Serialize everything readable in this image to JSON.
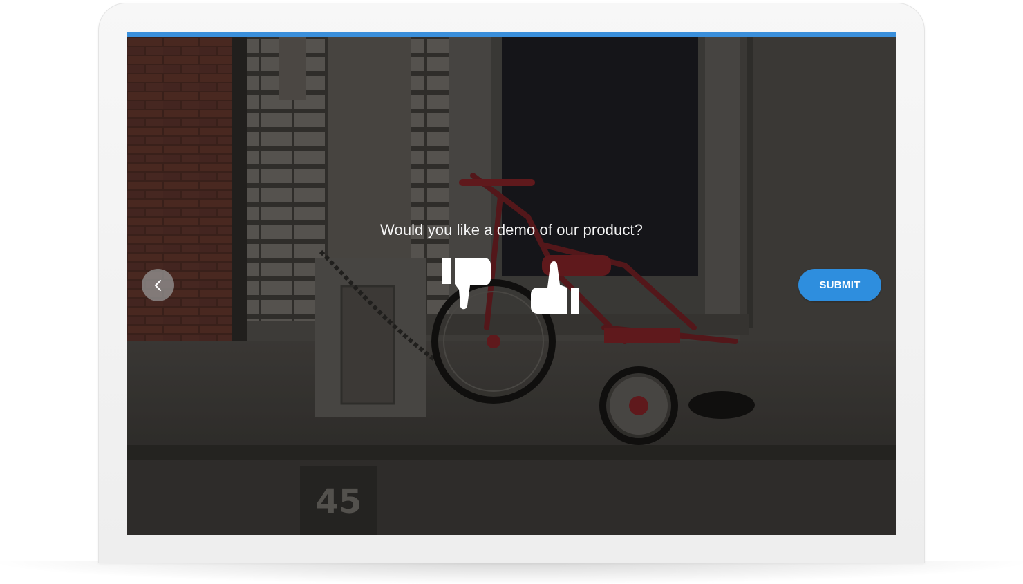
{
  "survey": {
    "progress_fraction": 1.0,
    "question": "Would you like a demo of our product?",
    "rating_options": [
      "thumbs-down",
      "thumbs-up"
    ],
    "prev_icon": "chevron-left-icon",
    "submit_label": "SUBMIT",
    "background_scene": {
      "icon": "tricycle-photo",
      "curb_number": "45"
    }
  },
  "colors": {
    "accent": "#2e8ede",
    "progress": "#3a8fdb",
    "text": "#f4f4f4"
  }
}
